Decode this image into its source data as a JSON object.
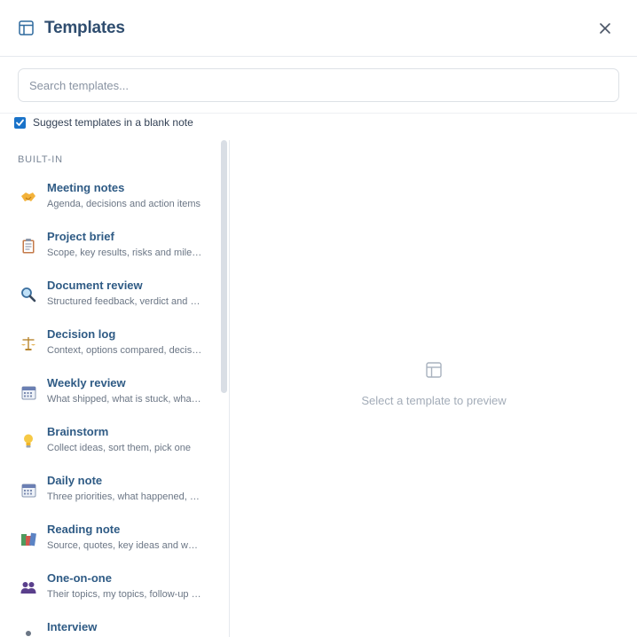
{
  "header": {
    "title": "Templates",
    "icon": "template-layout-icon",
    "close_icon": "close-icon"
  },
  "search": {
    "placeholder": "Search templates...",
    "value": ""
  },
  "suggest": {
    "label": "Suggest templates in a blank note",
    "checked": true
  },
  "sidebar": {
    "section_label": "BUILT-IN",
    "items": [
      {
        "name": "Meeting notes",
        "desc": "Agenda, decisions and action items",
        "icon": "handshake-icon"
      },
      {
        "name": "Project brief",
        "desc": "Scope, key results, risks and milestones",
        "icon": "clipboard-icon"
      },
      {
        "name": "Document review",
        "desc": "Structured feedback, verdict and follow-ups",
        "icon": "magnifier-icon"
      },
      {
        "name": "Decision log",
        "desc": "Context, options compared, decision and rationale",
        "icon": "scales-icon"
      },
      {
        "name": "Weekly review",
        "desc": "What shipped, what is stuck, what is next",
        "icon": "calendar-icon"
      },
      {
        "name": "Brainstorm",
        "desc": "Collect ideas, sort them, pick one",
        "icon": "lightbulb-icon"
      },
      {
        "name": "Daily note",
        "desc": "Three priorities, what happened, notes",
        "icon": "calendar-icon"
      },
      {
        "name": "Reading note",
        "desc": "Source, quotes, key ideas and what to do",
        "icon": "books-icon"
      },
      {
        "name": "One-on-one",
        "desc": "Their topics, my topics, follow-up items",
        "icon": "people-icon"
      },
      {
        "name": "Interview",
        "desc": "",
        "icon": "person-icon"
      }
    ]
  },
  "preview": {
    "empty_text": "Select a template to preview",
    "icon": "template-layout-icon"
  },
  "colors": {
    "accent": "#1a73c9",
    "title": "#2f4d6f",
    "item_title": "#2f5b85",
    "muted": "#a3acb8"
  }
}
